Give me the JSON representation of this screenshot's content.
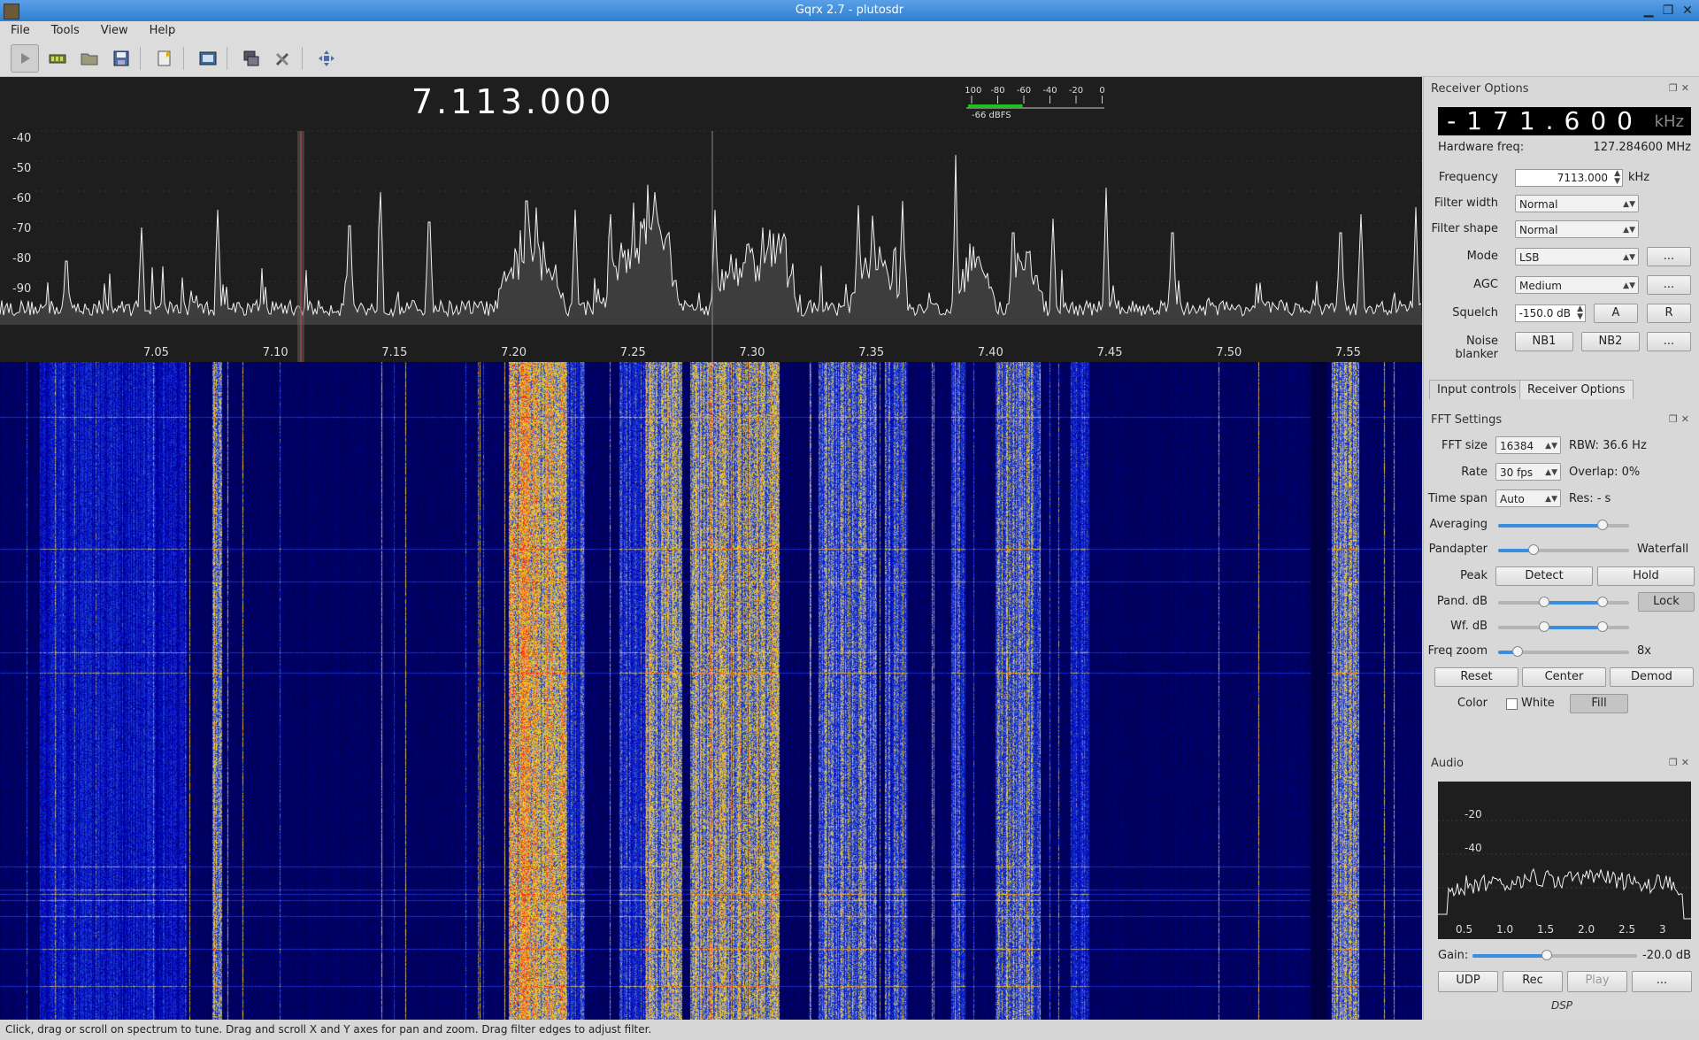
{
  "window": {
    "title": "Gqrx 2.7 - plutosdr"
  },
  "menu": [
    "File",
    "Tools",
    "View",
    "Help"
  ],
  "toolbar": {
    "icons": [
      "play-icon",
      "sdr-device-icon",
      "open-folder-icon",
      "save-icon",
      "import-icon",
      "config-icon",
      "network-icon",
      "tools-icon",
      "fullscreen-icon"
    ]
  },
  "plotter": {
    "frequency_display": "7.113.000",
    "smeter": {
      "ticks": [
        "-100",
        "-80",
        "-60",
        "-40",
        "-20",
        "0"
      ],
      "readout": "-66 dBFS",
      "level_dbfs": -66
    },
    "y_labels": [
      "-40",
      "-50",
      "-60",
      "-70",
      "-80",
      "-90"
    ],
    "x_labels": [
      "7.05",
      "7.10",
      "7.15",
      "7.20",
      "7.25",
      "7.30",
      "7.35",
      "7.40",
      "7.45",
      "7.50",
      "7.55"
    ]
  },
  "status_bar": "Click, drag or scroll on spectrum to tune. Drag and scroll X and Y axes for pan and zoom. Drag filter edges to adjust filter.",
  "receiver": {
    "header": "Receiver Options",
    "offset_value": "-171.600",
    "offset_unit": "kHz",
    "hw_freq_label": "Hardware freq:",
    "hw_freq_value": "127.284600 MHz",
    "frequency_label": "Frequency",
    "frequency_value": "7113.000",
    "frequency_unit": "kHz",
    "filter_width_label": "Filter width",
    "filter_width_value": "Normal",
    "filter_shape_label": "Filter shape",
    "filter_shape_value": "Normal",
    "mode_label": "Mode",
    "mode_value": "LSB",
    "agc_label": "AGC",
    "agc_value": "Medium",
    "squelch_label": "Squelch",
    "squelch_value": "-150.0 dB",
    "squelch_a": "A",
    "squelch_r": "R",
    "noise_blanker_label": "Noise blanker",
    "nb1": "NB1",
    "nb2": "NB2",
    "more": "..."
  },
  "tabs": [
    "Input controls",
    "Receiver Options"
  ],
  "fft": {
    "header": "FFT Settings",
    "fft_size_label": "FFT size",
    "fft_size_value": "16384",
    "rbw": "RBW: 36.6 Hz",
    "rate_label": "Rate",
    "rate_value": "30 fps",
    "overlap": "Overlap: 0%",
    "timespan_label": "Time span",
    "timespan_value": "Auto",
    "res": "Res: - s",
    "averaging_label": "Averaging",
    "pandapter_label": "Pandapter",
    "waterfall_label": "Waterfall",
    "peak_label": "Peak",
    "detect": "Detect",
    "hold": "Hold",
    "pand_db_label": "Pand. dB",
    "lock": "Lock",
    "wf_db_label": "Wf. dB",
    "freq_zoom_label": "Freq zoom",
    "freq_zoom_value": "8x",
    "reset": "Reset",
    "center": "Center",
    "demod": "Demod",
    "color_label": "Color",
    "white": "White",
    "fill": "Fill",
    "levels": {
      "averaging": 0.8,
      "pandapter_split": 0.27,
      "pand_db_low": 0.35,
      "pand_db_high": 0.8,
      "wf_db_low": 0.35,
      "wf_db_high": 0.8,
      "freq_zoom": 0.15
    }
  },
  "audio": {
    "header": "Audio",
    "y_labels": [
      "-20",
      "-40"
    ],
    "x_labels": [
      "0.5",
      "1.0",
      "1.5",
      "2.0",
      "2.5",
      "3"
    ],
    "gain_label": "Gain:",
    "gain_value": "-20.0 dB",
    "gain_level": 0.45,
    "udp": "UDP",
    "rec": "Rec",
    "play": "Play",
    "more": "...",
    "dsp": "DSP"
  }
}
